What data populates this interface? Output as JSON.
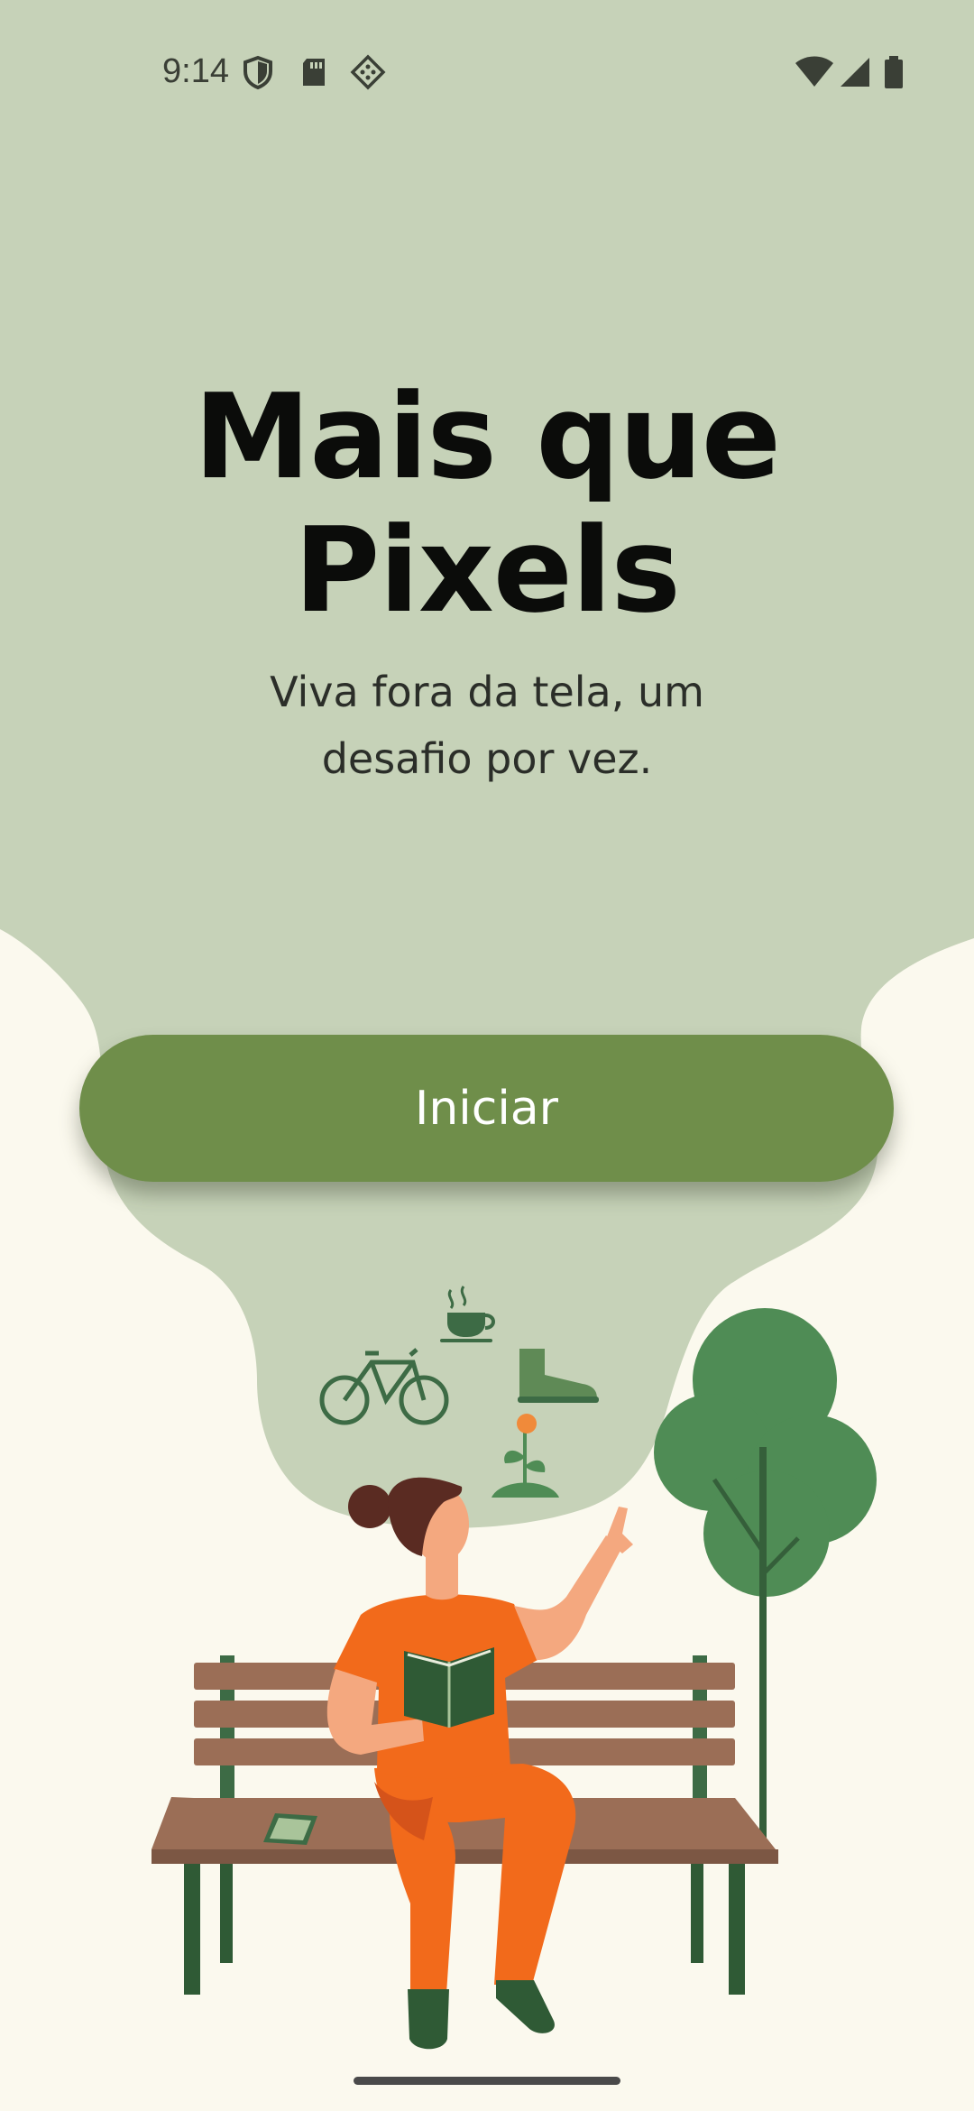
{
  "status_bar": {
    "time": "9:14",
    "left_icons": [
      "shield-icon",
      "sd-card-icon",
      "dotted-diamond-icon"
    ],
    "right_icons": [
      "wifi-icon",
      "cellular-signal-icon",
      "battery-icon"
    ]
  },
  "hero": {
    "title": "Mais que Pixels",
    "subtitle": "Viva fora da tela, um desafio por vez."
  },
  "start_button": {
    "label": "Iniciar"
  },
  "illustration": {
    "icons": [
      "coffee-cup-icon",
      "bicycle-icon",
      "hiking-boot-icon",
      "flower-icon"
    ],
    "scene": [
      "person-reading-on-bench",
      "tree",
      "phone-on-bench"
    ]
  },
  "colors": {
    "background_top": "#c6d2b8",
    "background_bottom": "#fbf9ee",
    "button": "#6f8e4a",
    "tree": "#4f8c55",
    "shirt": "#f26a1b",
    "bench": "#9b6e56"
  }
}
